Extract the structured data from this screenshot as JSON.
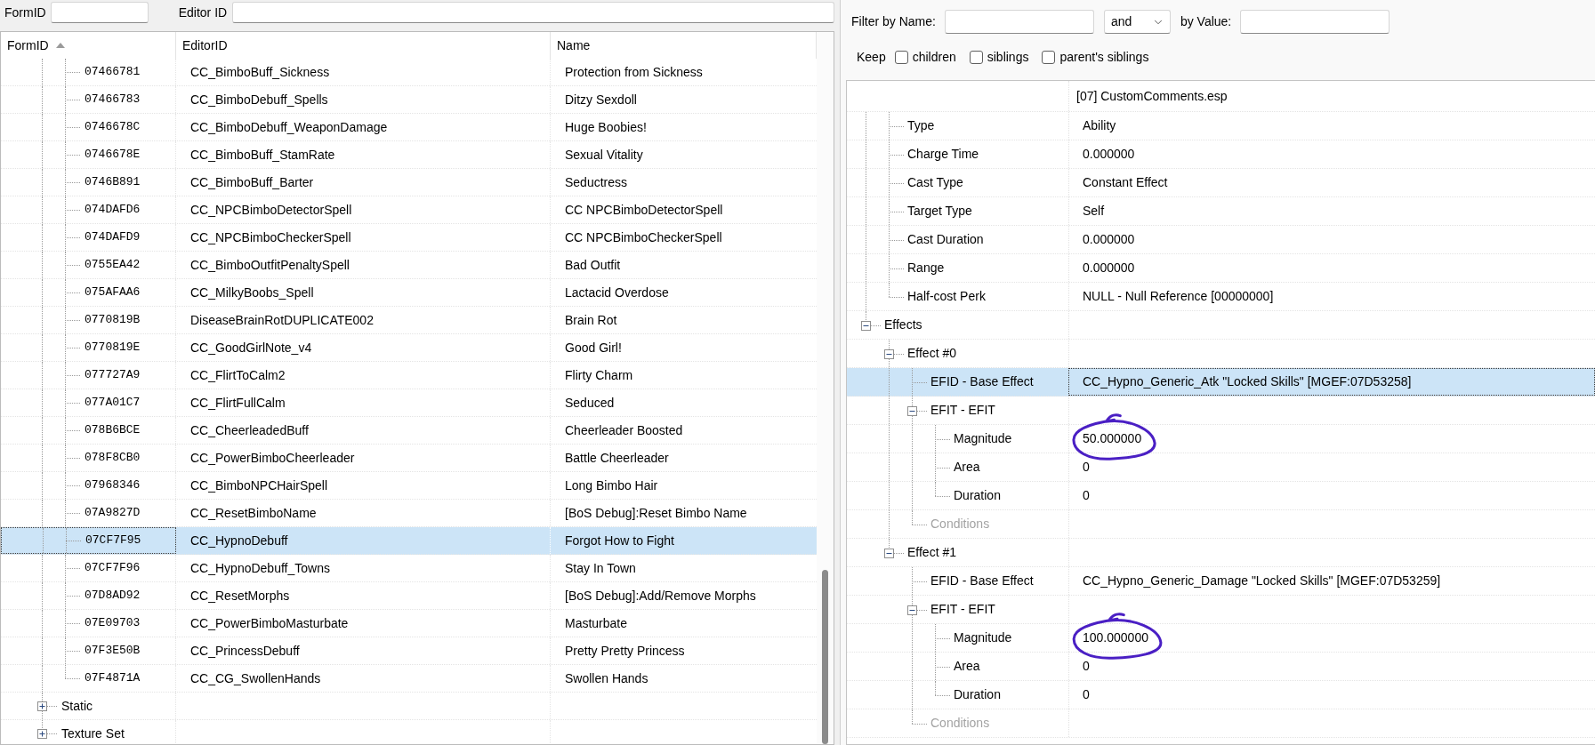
{
  "search_fields": [
    {
      "label": "FormID"
    },
    {
      "label": "Editor ID"
    }
  ],
  "records_table": {
    "columns": [
      {
        "label": "FormID",
        "sort_ascending": true
      },
      {
        "label": "EditorID"
      },
      {
        "label": "Name"
      }
    ],
    "rows": [
      {
        "children": [
          {
            "form_id": "07466781",
            "editor_id": "CC_BimboBuff_Sickness",
            "name": "Protection from Sickness",
            "selected": false
          },
          {
            "form_id": "07466783",
            "editor_id": "CC_BimboDebuff_Spells",
            "name": "Ditzy Sexdoll",
            "selected": false
          },
          {
            "form_id": "0746678C",
            "editor_id": "CC_BimboDebuff_WeaponDamage",
            "name": "Huge Boobies!",
            "selected": false
          },
          {
            "form_id": "0746678E",
            "editor_id": "CC_BimboBuff_StamRate",
            "name": "Sexual Vitality",
            "selected": false
          },
          {
            "form_id": "0746B891",
            "editor_id": "CC_BimboBuff_Barter",
            "name": "Seductress",
            "selected": false
          },
          {
            "form_id": "074DAFD6",
            "editor_id": "CC_NPCBimboDetectorSpell",
            "name": "CC NPCBimboDetectorSpell",
            "selected": false
          },
          {
            "form_id": "074DAFD9",
            "editor_id": "CC_NPCBimboCheckerSpell",
            "name": "CC NPCBimboCheckerSpell",
            "selected": false
          },
          {
            "form_id": "0755EA42",
            "editor_id": "CC_BimboOutfitPenaltySpell",
            "name": "Bad Outfit",
            "selected": false
          },
          {
            "form_id": "075AFAA6",
            "editor_id": "CC_MilkyBoobs_Spell",
            "name": "Lactacid Overdose",
            "selected": false
          },
          {
            "form_id": "0770819B",
            "editor_id": "DiseaseBrainRotDUPLICATE002",
            "name": "Brain Rot",
            "selected": false
          },
          {
            "form_id": "0770819E",
            "editor_id": "CC_GoodGirlNote_v4",
            "name": "Good Girl!",
            "selected": false
          },
          {
            "form_id": "077727A9",
            "editor_id": "CC_FlirtToCalm2",
            "name": "Flirty Charm",
            "selected": false
          },
          {
            "form_id": "077A01C7",
            "editor_id": "CC_FlirtFullCalm",
            "name": "Seduced",
            "selected": false
          },
          {
            "form_id": "078B6BCE",
            "editor_id": "CC_CheerleadedBuff",
            "name": "Cheerleader Boosted",
            "selected": false
          },
          {
            "form_id": "078F8CB0",
            "editor_id": "CC_PowerBimboCheerleader",
            "name": "Battle Cheerleader",
            "selected": false
          },
          {
            "form_id": "07968346",
            "editor_id": "CC_BimboNPCHairSpell",
            "name": "Long Bimbo Hair",
            "selected": false
          },
          {
            "form_id": "07A9827D",
            "editor_id": "CC_ResetBimboName",
            "name": "[BoS Debug]:Reset Bimbo Name",
            "selected": false
          },
          {
            "form_id": "07CF7F95",
            "editor_id": "CC_HypnoDebuff",
            "name": "Forgot How to Fight",
            "selected": true
          },
          {
            "form_id": "07CF7F96",
            "editor_id": "CC_HypnoDebuff_Towns",
            "name": "Stay In Town",
            "selected": false
          },
          {
            "form_id": "07D8AD92",
            "editor_id": "CC_ResetMorphs",
            "name": "[BoS Debug]:Add/Remove Morphs",
            "selected": false
          },
          {
            "form_id": "07E09703",
            "editor_id": "CC_PowerBimboMasturbate",
            "name": "Masturbate",
            "selected": false
          },
          {
            "form_id": "07F3E50B",
            "editor_id": "CC_PrincessDebuff",
            "name": "Pretty Pretty Princess",
            "selected": false
          },
          {
            "form_id": "07F4871A",
            "editor_id": "CC_CG_SwollenHands",
            "name": "Swollen Hands",
            "selected": false
          }
        ]
      },
      {
        "label": "Static",
        "expanded": false,
        "selected": false
      },
      {
        "label": "Texture Set",
        "expanded": false,
        "selected": false
      }
    ]
  },
  "filter": {
    "name": {
      "label": "Filter by Name:"
    },
    "operator": "and",
    "value": {
      "label": "by Value:"
    },
    "keep": {
      "label": "Keep",
      "options": [
        {
          "label": "children",
          "checked": false
        },
        {
          "label": "siblings",
          "checked": false
        },
        {
          "label": "parent's siblings",
          "checked": false
        }
      ]
    }
  },
  "record_view": {
    "header": "[07] CustomComments.esp",
    "rows": [
      {
        "children": [
          {
            "label": "Type",
            "value": "Ability",
            "selected": false,
            "disabled": false,
            "circled": false
          },
          {
            "label": "Charge Time",
            "value": "0.000000",
            "selected": false,
            "disabled": false,
            "circled": false
          },
          {
            "label": "Cast Type",
            "value": "Constant Effect",
            "selected": false,
            "disabled": false,
            "circled": false
          },
          {
            "label": "Target Type",
            "value": "Self",
            "selected": false,
            "disabled": false,
            "circled": false
          },
          {
            "label": "Cast Duration",
            "value": "0.000000",
            "selected": false,
            "disabled": false,
            "circled": false
          },
          {
            "label": "Range",
            "value": "0.000000",
            "selected": false,
            "disabled": false,
            "circled": false
          },
          {
            "label": "Half-cost Perk",
            "value": "NULL - Null Reference [00000000]",
            "selected": false,
            "disabled": false,
            "circled": false
          }
        ]
      },
      {
        "label": "Effects",
        "expanded": true,
        "selected": false,
        "disabled": false,
        "circled": false,
        "children": [
          {
            "label": "Effect #0",
            "expanded": true,
            "selected": false,
            "disabled": false,
            "circled": false,
            "children": [
              {
                "label": "EFID - Base Effect",
                "value": "CC_Hypno_Generic_Atk \"Locked Skills\" [MGEF:07D53258]",
                "selected": true,
                "disabled": false,
                "circled": false
              },
              {
                "label": "EFIT - EFIT",
                "expanded": true,
                "selected": false,
                "disabled": false,
                "circled": false,
                "children": [
                  {
                    "label": "Magnitude",
                    "value": "50.000000",
                    "selected": false,
                    "disabled": false,
                    "circled": true
                  },
                  {
                    "label": "Area",
                    "value": "0",
                    "selected": false,
                    "disabled": false,
                    "circled": false
                  },
                  {
                    "label": "Duration",
                    "value": "0",
                    "selected": false,
                    "disabled": false,
                    "circled": false
                  }
                ]
              },
              {
                "label": "Conditions",
                "selected": false,
                "disabled": true,
                "circled": false
              }
            ]
          },
          {
            "label": "Effect #1",
            "expanded": true,
            "selected": false,
            "disabled": false,
            "circled": false,
            "children": [
              {
                "label": "EFID - Base Effect",
                "value": "CC_Hypno_Generic_Damage \"Locked Skills\" [MGEF:07D53259]",
                "selected": false,
                "disabled": false,
                "circled": false
              },
              {
                "label": "EFIT - EFIT",
                "expanded": true,
                "selected": false,
                "disabled": false,
                "circled": false,
                "children": [
                  {
                    "label": "Magnitude",
                    "value": "100.000000",
                    "selected": false,
                    "disabled": false,
                    "circled": true
                  },
                  {
                    "label": "Area",
                    "value": "0",
                    "selected": false,
                    "disabled": false,
                    "circled": false
                  },
                  {
                    "label": "Duration",
                    "value": "0",
                    "selected": false,
                    "disabled": false,
                    "circled": false
                  }
                ]
              },
              {
                "label": "Conditions",
                "selected": false,
                "disabled": true,
                "circled": false
              }
            ]
          }
        ]
      }
    ]
  }
}
